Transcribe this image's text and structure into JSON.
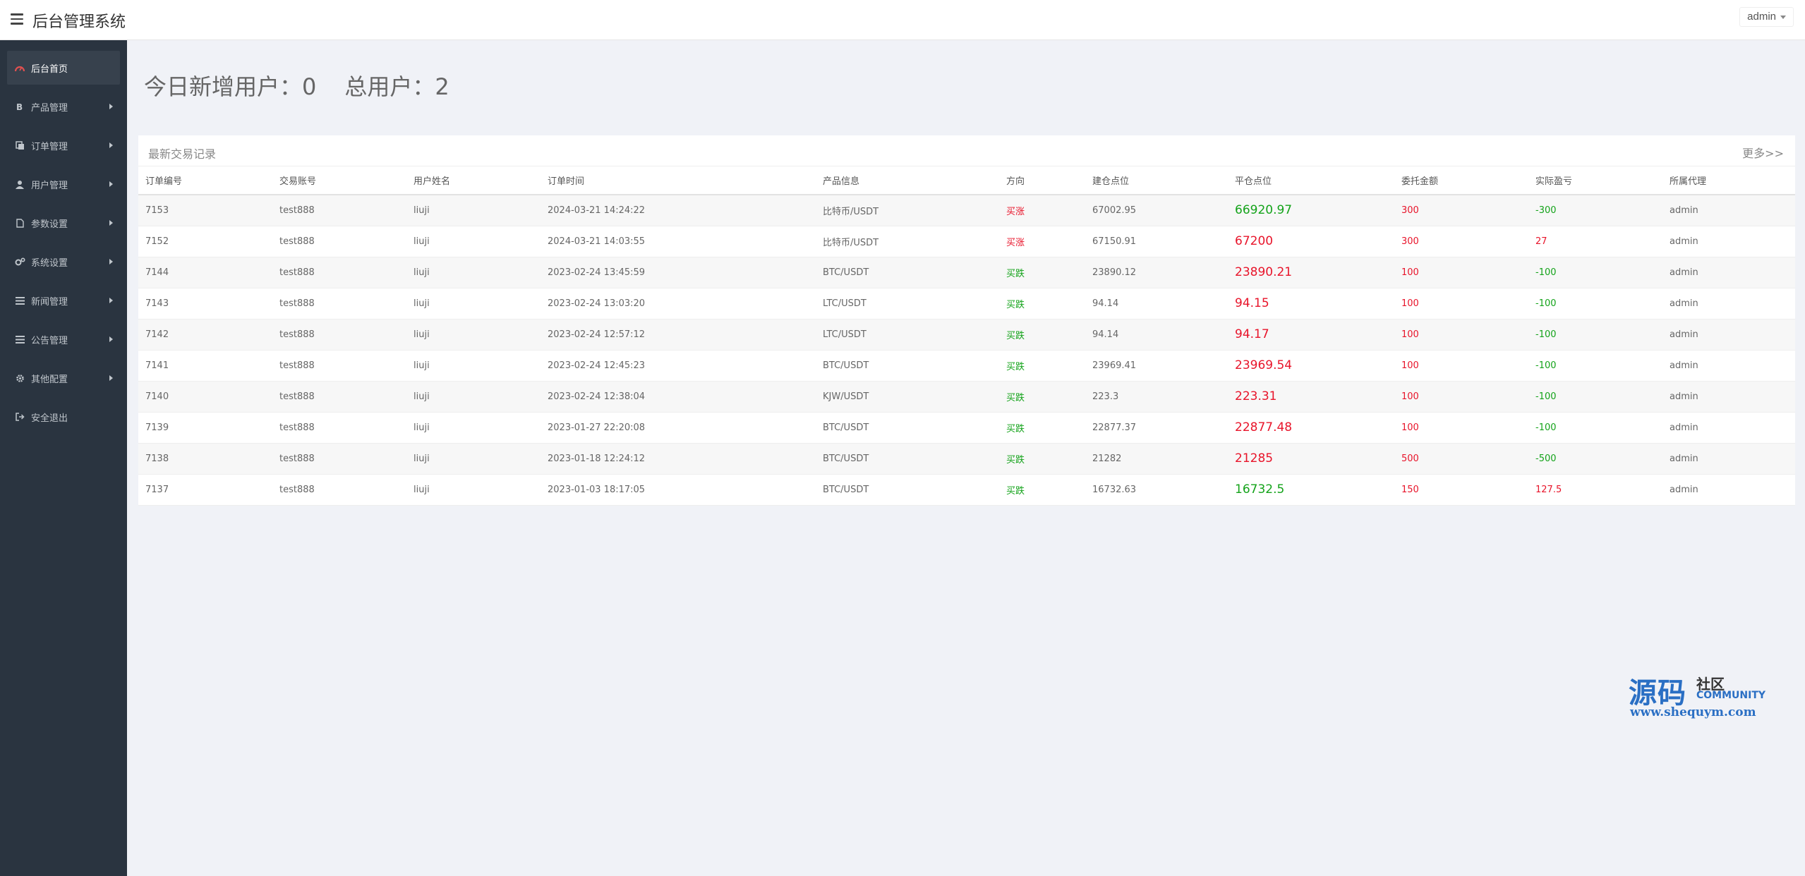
{
  "header": {
    "title": "后台管理系统",
    "user": "admin"
  },
  "sidebar": {
    "items": [
      {
        "label": "后台首页",
        "icon": "dashboard-icon",
        "active": true,
        "arrow": false
      },
      {
        "label": "产品管理",
        "icon": "bitcoin-icon",
        "active": false,
        "arrow": true
      },
      {
        "label": "订单管理",
        "icon": "copy-icon",
        "active": false,
        "arrow": true
      },
      {
        "label": "用户管理",
        "icon": "user-icon",
        "active": false,
        "arrow": true
      },
      {
        "label": "参数设置",
        "icon": "file-icon",
        "active": false,
        "arrow": true
      },
      {
        "label": "系统设置",
        "icon": "gears-icon",
        "active": false,
        "arrow": true
      },
      {
        "label": "新闻管理",
        "icon": "list-icon",
        "active": false,
        "arrow": true
      },
      {
        "label": "公告管理",
        "icon": "list-icon",
        "active": false,
        "arrow": true
      },
      {
        "label": "其他配置",
        "icon": "gear-icon",
        "active": false,
        "arrow": true
      },
      {
        "label": "安全退出",
        "icon": "sign-out-icon",
        "active": false,
        "arrow": false
      }
    ]
  },
  "stats": {
    "today_label": "今日新增用户：",
    "today_value": "0",
    "total_label": "总用户：",
    "total_value": "2"
  },
  "panel": {
    "title": "最新交易记录",
    "more": "更多>>"
  },
  "table": {
    "columns": [
      "订单编号",
      "交易账号",
      "用户姓名",
      "订单时间",
      "产品信息",
      "方向",
      "建仓点位",
      "平仓点位",
      "委托金额",
      "实际盈亏",
      "所属代理"
    ],
    "rows": [
      {
        "id": "7153",
        "account": "test888",
        "name": "liuji",
        "time": "2024-03-21 14:24:22",
        "product": "比特币/USDT",
        "dir": "买涨",
        "dir_color": "red",
        "open": "67002.95",
        "close": "66920.97",
        "close_color": "green",
        "amount": "300",
        "pnl": "-300",
        "pnl_color": "green",
        "agent": "admin"
      },
      {
        "id": "7152",
        "account": "test888",
        "name": "liuji",
        "time": "2024-03-21 14:03:55",
        "product": "比特币/USDT",
        "dir": "买涨",
        "dir_color": "red",
        "open": "67150.91",
        "close": "67200",
        "close_color": "red",
        "amount": "300",
        "pnl": "27",
        "pnl_color": "red",
        "agent": "admin"
      },
      {
        "id": "7144",
        "account": "test888",
        "name": "liuji",
        "time": "2023-02-24 13:45:59",
        "product": "BTC/USDT",
        "dir": "买跌",
        "dir_color": "green",
        "open": "23890.12",
        "close": "23890.21",
        "close_color": "red",
        "amount": "100",
        "pnl": "-100",
        "pnl_color": "green",
        "agent": "admin"
      },
      {
        "id": "7143",
        "account": "test888",
        "name": "liuji",
        "time": "2023-02-24 13:03:20",
        "product": "LTC/USDT",
        "dir": "买跌",
        "dir_color": "green",
        "open": "94.14",
        "close": "94.15",
        "close_color": "red",
        "amount": "100",
        "pnl": "-100",
        "pnl_color": "green",
        "agent": "admin"
      },
      {
        "id": "7142",
        "account": "test888",
        "name": "liuji",
        "time": "2023-02-24 12:57:12",
        "product": "LTC/USDT",
        "dir": "买跌",
        "dir_color": "green",
        "open": "94.14",
        "close": "94.17",
        "close_color": "red",
        "amount": "100",
        "pnl": "-100",
        "pnl_color": "green",
        "agent": "admin"
      },
      {
        "id": "7141",
        "account": "test888",
        "name": "liuji",
        "time": "2023-02-24 12:45:23",
        "product": "BTC/USDT",
        "dir": "买跌",
        "dir_color": "green",
        "open": "23969.41",
        "close": "23969.54",
        "close_color": "red",
        "amount": "100",
        "pnl": "-100",
        "pnl_color": "green",
        "agent": "admin"
      },
      {
        "id": "7140",
        "account": "test888",
        "name": "liuji",
        "time": "2023-02-24 12:38:04",
        "product": "KJW/USDT",
        "dir": "买跌",
        "dir_color": "green",
        "open": "223.3",
        "close": "223.31",
        "close_color": "red",
        "amount": "100",
        "pnl": "-100",
        "pnl_color": "green",
        "agent": "admin"
      },
      {
        "id": "7139",
        "account": "test888",
        "name": "liuji",
        "time": "2023-01-27 22:20:08",
        "product": "BTC/USDT",
        "dir": "买跌",
        "dir_color": "green",
        "open": "22877.37",
        "close": "22877.48",
        "close_color": "red",
        "amount": "100",
        "pnl": "-100",
        "pnl_color": "green",
        "agent": "admin"
      },
      {
        "id": "7138",
        "account": "test888",
        "name": "liuji",
        "time": "2023-01-18 12:24:12",
        "product": "BTC/USDT",
        "dir": "买跌",
        "dir_color": "green",
        "open": "21282",
        "close": "21285",
        "close_color": "red",
        "amount": "500",
        "pnl": "-500",
        "pnl_color": "green",
        "agent": "admin"
      },
      {
        "id": "7137",
        "account": "test888",
        "name": "liuji",
        "time": "2023-01-03 18:17:05",
        "product": "BTC/USDT",
        "dir": "买跌",
        "dir_color": "green",
        "open": "16732.63",
        "close": "16732.5",
        "close_color": "green",
        "amount": "150",
        "pnl": "127.5",
        "pnl_color": "red",
        "agent": "admin"
      }
    ]
  },
  "watermark": {
    "main": "源码",
    "cn": "社区",
    "en": "COMMUNITY",
    "url": "www.shequym.com"
  },
  "colors": {
    "up": "#e8142a",
    "down": "#14a31a",
    "sidebar_bg": "#2a3440",
    "brand": "#2a6fc4"
  }
}
